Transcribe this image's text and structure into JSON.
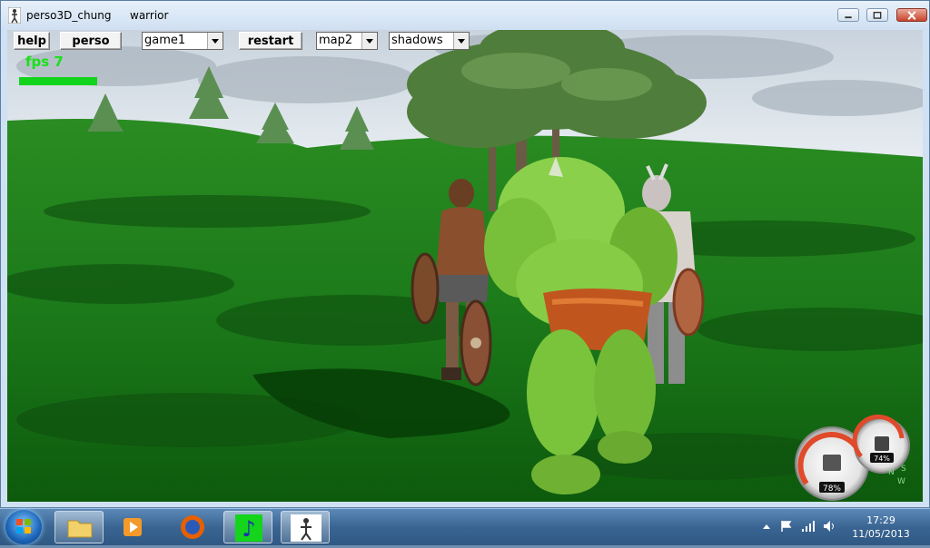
{
  "window": {
    "title": "perso3D_chung",
    "subtitle": "warrior"
  },
  "toolbar": {
    "help_label": "help",
    "perso_label": "perso",
    "game_select": "game1",
    "restart_label": "restart",
    "map_select": "map2",
    "shadows_select": "shadows"
  },
  "hud": {
    "fps_text": "fps 7",
    "cpu_percent": "78%",
    "mem_percent": "74%",
    "compass": [
      "N",
      "S",
      "W"
    ]
  },
  "taskbar": {
    "apps": [
      "windows-explorer",
      "media-player",
      "firefox",
      "music-app",
      "perso3d"
    ],
    "clock_time": "17:29",
    "clock_date": "11/05/2013"
  },
  "colors": {
    "fps": "#19e019",
    "grass": "#1a7a1a",
    "ogre": "#7cc932"
  }
}
